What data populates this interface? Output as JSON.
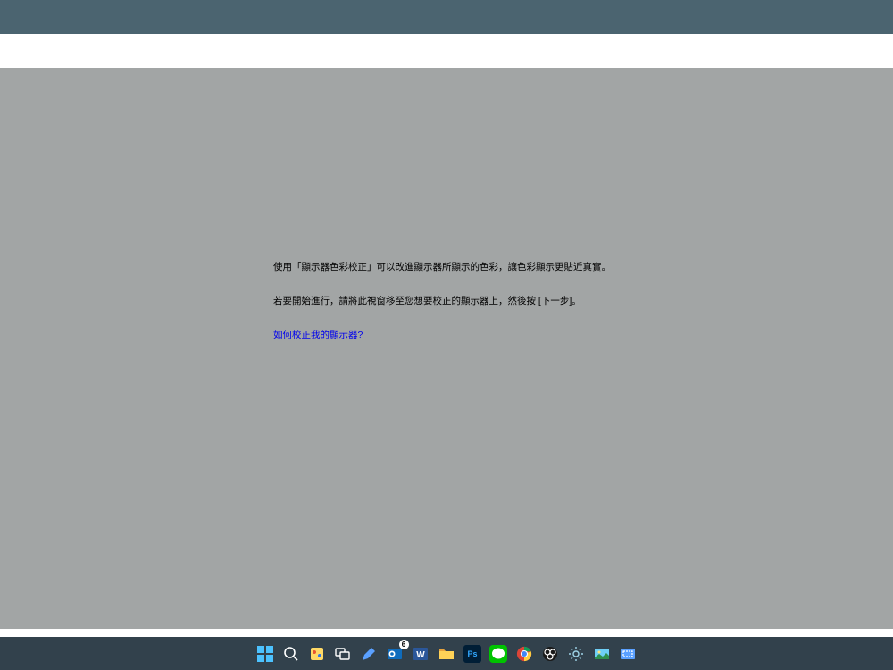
{
  "dialog": {
    "paragraph1": "使用「顯示器色彩校正」可以改進顯示器所顯示的色彩，讓色彩顯示更貼近真實。",
    "paragraph2": "若要開始進行，請將此視窗移至您想要校正的顯示器上，然後按 [下一步]。",
    "help_link": "如何校正我的顯示器?"
  },
  "taskbar": {
    "outlook_badge": "6"
  }
}
